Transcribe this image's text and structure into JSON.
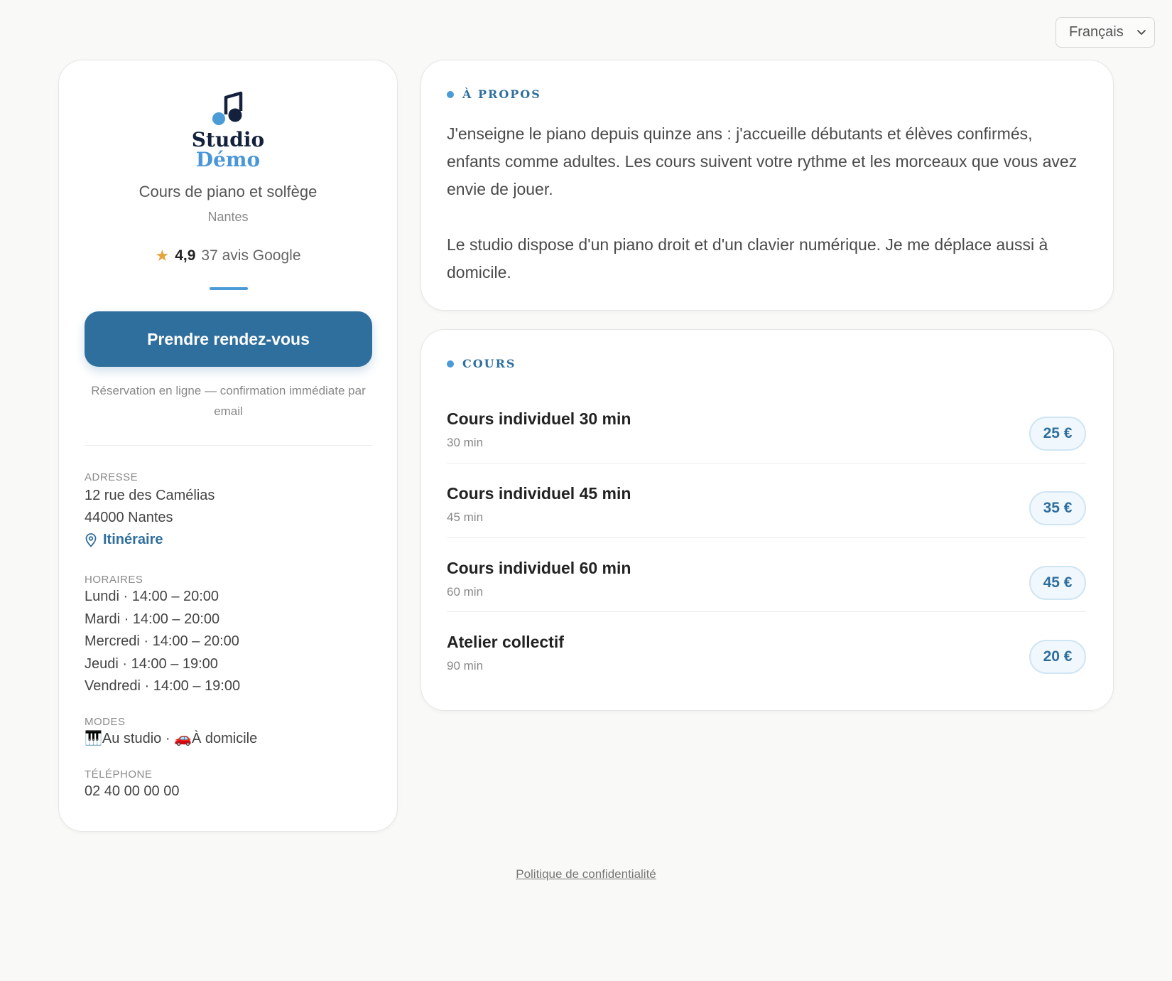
{
  "language": {
    "selected": "Français"
  },
  "profile": {
    "logo": {
      "line1": "Studio",
      "line2": "Démo"
    },
    "subtitle": "Cours de piano et solfège",
    "city": "Nantes",
    "rating": {
      "score": "4,9",
      "reviews": "37 avis Google",
      "stars_icon": "★"
    },
    "cta_label": "Prendre rendez-vous",
    "cta_note": "Réservation en ligne — confirmation immédiate par email",
    "address": {
      "label": "ADRESSE",
      "line1": "12 rue des Camélias",
      "line2": "44000 Nantes",
      "directions_label": "Itinéraire"
    },
    "hours": {
      "label": "HORAIRES",
      "days": [
        "Lundi · 14:00 – 20:00",
        "Mardi · 14:00 – 20:00",
        "Mercredi · 14:00 – 20:00",
        "Jeudi · 14:00 – 19:00",
        "Vendredi · 14:00 – 19:00"
      ]
    },
    "modes": {
      "label": "MODES",
      "value": "🎹Au studio · 🚗À domicile"
    },
    "phone": {
      "label": "TÉLÉPHONE",
      "value": "02 40 00 00 00"
    }
  },
  "about": {
    "title": "À PROPOS",
    "paragraphs": [
      "J'enseigne le piano depuis quinze ans : j'accueille débutants et élèves confirmés, enfants comme adultes. Les cours suivent votre rythme et les morceaux que vous avez envie de jouer.",
      "Le studio dispose d'un piano droit et d'un clavier numérique. Je me déplace aussi à domicile."
    ]
  },
  "courses": {
    "title": "COURS",
    "items": [
      {
        "name": "Cours individuel 30 min",
        "duration": "30 min",
        "price": "25 €"
      },
      {
        "name": "Cours individuel 45 min",
        "duration": "45 min",
        "price": "35 €"
      },
      {
        "name": "Cours individuel 60 min",
        "duration": "60 min",
        "price": "45 €"
      },
      {
        "name": "Atelier collectif",
        "duration": "90 min",
        "price": "20 €"
      }
    ]
  },
  "footer": {
    "privacy_label": "Politique de confidentialité"
  },
  "colors": {
    "accent": "#2f6f9e",
    "accent_light": "#4a9bd6",
    "star": "#e8a23a",
    "background": "#f9f9f7"
  }
}
